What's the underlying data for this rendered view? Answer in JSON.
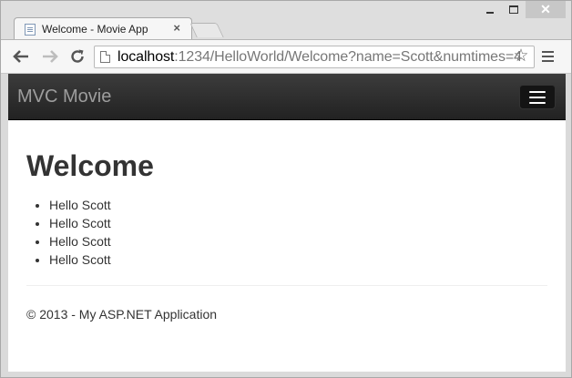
{
  "browser": {
    "tab_title": "Welcome - Movie App",
    "tab_close": "×",
    "window_close": "✕",
    "url_host": "localhost",
    "url_rest": ":1234/HelloWorld/Welcome?name=Scott&numtimes=4",
    "star_glyph": "☆"
  },
  "page": {
    "brand": "MVC Movie",
    "heading": "Welcome",
    "greetings": [
      "Hello Scott",
      "Hello Scott",
      "Hello Scott",
      "Hello Scott"
    ],
    "footer": "© 2013 - My ASP.NET Application"
  },
  "icons": {
    "back": "back-arrow-icon",
    "forward": "forward-arrow-icon",
    "reload": "reload-icon",
    "bookmark": "star-icon",
    "menu": "hamburger-menu-icon",
    "navbar_toggle": "hamburger-icon",
    "page": "page-icon",
    "favicon": "document-favicon-icon"
  },
  "colors": {
    "navbar_top": "#3c3c3c",
    "navbar_bottom": "#222222",
    "brand_text": "#9d9d9d",
    "body_text": "#333333",
    "window_close_bg": "#c7c7c7"
  }
}
